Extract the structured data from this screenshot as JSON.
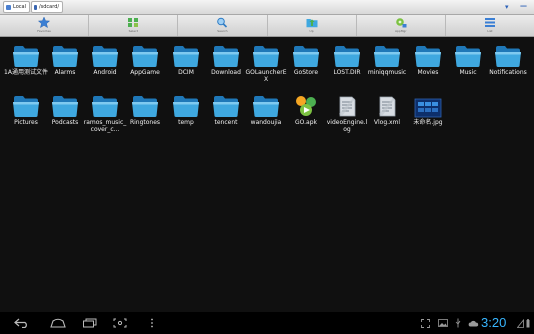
{
  "address": {
    "crumbs": [
      "Local",
      "/sdcard/"
    ]
  },
  "toolbar": {
    "tools": [
      {
        "label": "Favorites",
        "icon": "star-icon"
      },
      {
        "label": "Select",
        "icon": "select-icon"
      },
      {
        "label": "Search",
        "icon": "search-icon"
      },
      {
        "label": "Up",
        "icon": "up-folder-icon"
      },
      {
        "label": "AppMgr",
        "icon": "app-manager-icon"
      },
      {
        "label": "List",
        "icon": "list-view-icon"
      }
    ]
  },
  "files": [
    {
      "name": "1A通用测试文件",
      "type": "folder"
    },
    {
      "name": "Alarms",
      "type": "folder"
    },
    {
      "name": "Android",
      "type": "folder"
    },
    {
      "name": "AppGame",
      "type": "folder"
    },
    {
      "name": "DCIM",
      "type": "folder"
    },
    {
      "name": "Download",
      "type": "folder"
    },
    {
      "name": "GOLauncherEX",
      "type": "folder"
    },
    {
      "name": "GoStore",
      "type": "folder"
    },
    {
      "name": "LOST.DIR",
      "type": "folder"
    },
    {
      "name": "miniqqmusic",
      "type": "folder"
    },
    {
      "name": "Movies",
      "type": "folder"
    },
    {
      "name": "Music",
      "type": "folder"
    },
    {
      "name": "Notifications",
      "type": "folder"
    },
    {
      "name": "Pictures",
      "type": "folder"
    },
    {
      "name": "Podcasts",
      "type": "folder"
    },
    {
      "name": "ramos_music_cover_c...",
      "type": "folder"
    },
    {
      "name": "Ringtones",
      "type": "folder"
    },
    {
      "name": "temp",
      "type": "folder"
    },
    {
      "name": "tencent",
      "type": "folder"
    },
    {
      "name": "wandoujia",
      "type": "folder"
    },
    {
      "name": "GO.apk",
      "type": "apk"
    },
    {
      "name": "videoEngine.log",
      "type": "document"
    },
    {
      "name": "Vlog.xml",
      "type": "document"
    },
    {
      "name": "未命名.jpg",
      "type": "image"
    }
  ],
  "status": {
    "time": "3:20"
  },
  "colors": {
    "background": "#101010",
    "folder": "#3fa8e0",
    "clock": "#38b6ff"
  }
}
